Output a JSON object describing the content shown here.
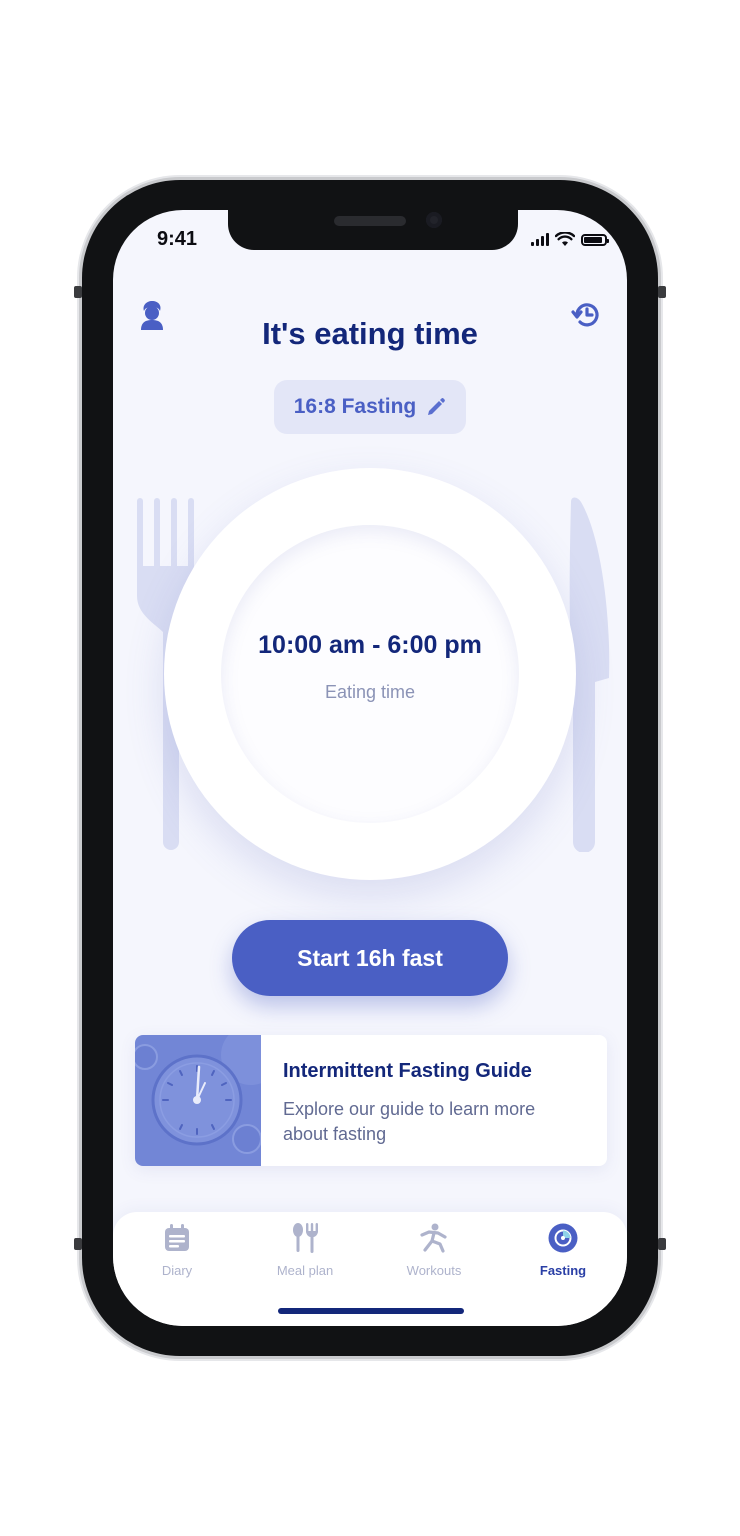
{
  "status_bar": {
    "time": "9:41"
  },
  "header": {
    "title": "It's eating time"
  },
  "plan_chip": {
    "label": "16:8 Fasting"
  },
  "plate": {
    "time_range": "10:00 am - 6:00 pm",
    "caption": "Eating time"
  },
  "primary_action": {
    "label": "Start 16h fast"
  },
  "guide_card": {
    "title": "Intermittent Fasting Guide",
    "description": "Explore our guide to learn more about fasting"
  },
  "tabbar": {
    "tabs": [
      {
        "label": "Diary",
        "icon": "calendar-icon",
        "active": false
      },
      {
        "label": "Meal plan",
        "icon": "cutlery-icon",
        "active": false
      },
      {
        "label": "Workouts",
        "icon": "running-figure-icon",
        "active": false
      },
      {
        "label": "Fasting",
        "icon": "fasting-timer-icon",
        "active": true
      }
    ]
  },
  "colors": {
    "primary": "#4a5fc4",
    "title": "#13277a",
    "background": "#f5f6fd",
    "tab_inactive": "#aeb3cc"
  }
}
